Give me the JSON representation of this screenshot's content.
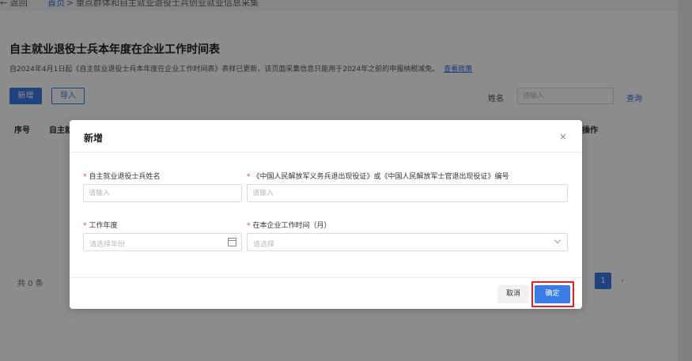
{
  "breadcrumb": {
    "back_label": "← 返回",
    "home_label": "首页",
    "separator": ">",
    "current_label": "重点群体和自主就业退役士兵创业就业信息采集"
  },
  "page": {
    "title": "自主就业退役士兵本年度在企业工作时间表",
    "description": "自2024年4月1日起《自主就业退役士兵本年度在企业工作时间表》表样已更新，该页面采集信息只能用于2024年之前的申报纳税减免。",
    "policy_link": "查看政策"
  },
  "toolbar": {
    "add_label": "新增",
    "import_label": "导入",
    "filter_name_label": "姓名",
    "filter_name_placeholder": "请输入",
    "query_label": "查询"
  },
  "table": {
    "columns": [
      "序号",
      "自主就",
      "操作"
    ]
  },
  "pagination": {
    "total_text": "共 0 条",
    "current_page": "1",
    "next": "›"
  },
  "modal": {
    "title": "新增",
    "close": "×",
    "required_mark": "*",
    "fields": [
      {
        "label": "自主就业退役士兵姓名",
        "placeholder": "请输入"
      },
      {
        "label": "《中国人民解放军义务兵退出现役证》或《中国人民解放军士官退出现役证》编号",
        "placeholder": "请输入"
      },
      {
        "label": "工作年度",
        "placeholder": "请选择年份"
      },
      {
        "label": "在本企业工作时间（月）",
        "placeholder": "请选择"
      }
    ],
    "cancel_label": "取消",
    "confirm_label": "确定"
  },
  "colors": {
    "primary": "#3a7be8",
    "link": "#2f6fe0",
    "required": "#e5484d",
    "highlight": "#e02020"
  }
}
